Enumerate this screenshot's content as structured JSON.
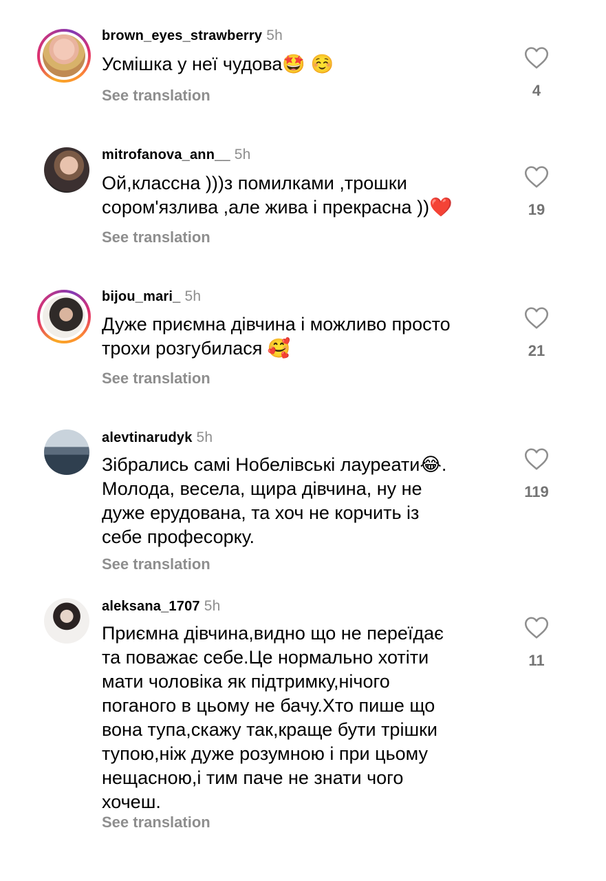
{
  "comments": [
    {
      "username": "brown_eyes_strawberry",
      "time": "5h",
      "text": "Усмішка у неї чудова🤩 ☺️",
      "translate": "See translation",
      "likes": "4",
      "avatar_icon": "profile-photo-icon"
    },
    {
      "username": "mitrofanova_ann__",
      "time": "5h",
      "text": "Ой,классна )))з помилками ,трошки\nсором'язлива ,але жива і прекрасна ))❤️",
      "translate": "See translation",
      "likes": "19",
      "avatar_icon": "profile-photo-icon"
    },
    {
      "username": "bijou_mari_",
      "time": "5h",
      "text": "Дуже приємна дівчина і можливо просто\nтрохи розгубилася 🥰",
      "translate": "See translation",
      "likes": "21",
      "avatar_icon": "profile-photo-icon"
    },
    {
      "username": "alevtinarudyk",
      "time": "5h",
      "text": "Зібрались самі Нобелівські лауреати😂.\nМолода, весела, щира дівчина, ну не\nдуже ерудована, та хоч не корчить із\nсебе професорку.",
      "translate": "See translation",
      "likes": "119",
      "avatar_icon": "profile-photo-icon"
    },
    {
      "username": "aleksana_1707",
      "time": "5h",
      "text": "Приємна дівчина,видно що не переїдає\nта поважає себе.Це нормально хотіти\nмати чоловіка як підтримку,нічого\nпоганого в цьому не бачу.Хто пише що\nвона тупа,скажу так,краще бути трішки\nтупою,ніж дуже розумною і при цьому\nнещасною,і тим паче не знати чого\nхочеш.",
      "translate": "See translation",
      "likes": "11",
      "avatar_icon": "profile-photo-icon"
    }
  ],
  "icons": {
    "like": "heart-outline-icon"
  },
  "colors": {
    "text": "#000000",
    "muted": "#8e8e8e",
    "story_ring": "#e1306c"
  }
}
